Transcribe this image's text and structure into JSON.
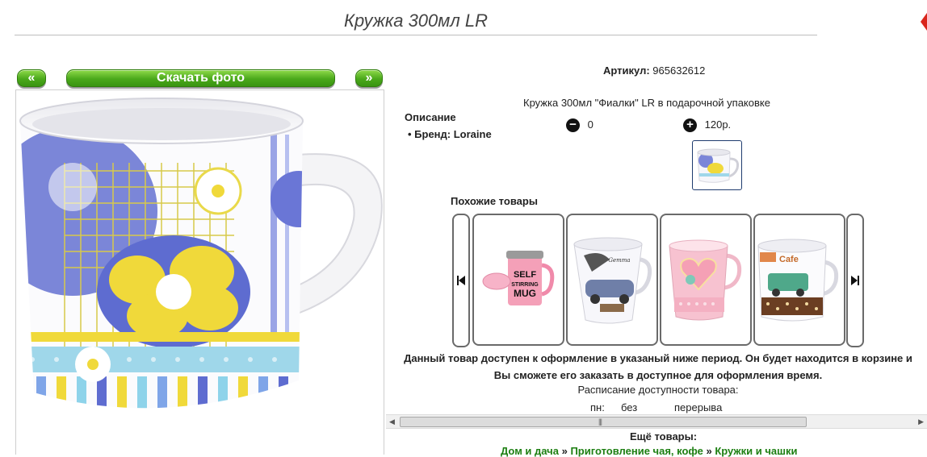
{
  "page": {
    "title": "Кружка 300мл LR"
  },
  "gallery": {
    "prev_label": "«",
    "next_label": "»",
    "download_label": "Скачать фото"
  },
  "product": {
    "article_label": "Артикул:",
    "article_value": "965632612",
    "full_name": "Кружка 300мл \"Фиалки\" LR в подарочной упаковке",
    "description_heading": "Описание",
    "brand_line": "Бренд: Loraine",
    "quantity": "0",
    "price": "120р."
  },
  "similar": {
    "heading": "Похожие товары",
    "items": [
      {
        "name": "self-stirring-mug",
        "text_line1": "SELF",
        "text_line2": "STIRRING",
        "text_line3": "MUG"
      },
      {
        "name": "car-print-mug",
        "logo": "Gemma"
      },
      {
        "name": "heart-pink-mug"
      },
      {
        "name": "retro-car-mug",
        "caption": "Cafe"
      }
    ]
  },
  "availability": {
    "notice": "Данный товар доступен к оформление в указаный ниже период. Он будет находится в корзине и Вы сможете его заказать в доступное для оформления время.",
    "schedule_label": "Расписание доступности товара:",
    "day": "пн:",
    "hours": "без",
    "break": "перерыва"
  },
  "more": {
    "heading": "Ещё товары:",
    "breadcrumbs": [
      "Дом и дача",
      "Приготовление чая, кофе",
      "Кружки и чашки"
    ],
    "separator": "»"
  },
  "colors": {
    "accent_green": "#4aa81b",
    "link_green": "#1d7f12",
    "thumb_border": "#1e3b6e"
  }
}
